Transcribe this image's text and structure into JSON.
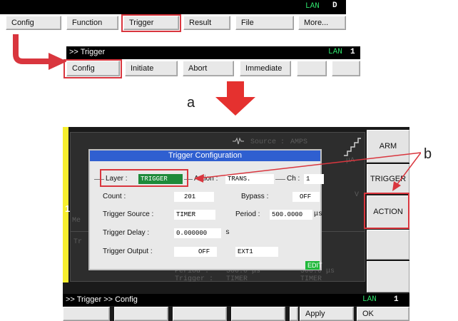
{
  "top_bar": {
    "lan_label": "LAN",
    "lan_value": "D",
    "buttons": [
      "Config",
      "Function",
      "Trigger",
      "Result",
      "File",
      "More..."
    ]
  },
  "second_bar": {
    "title": ">> Trigger",
    "lan_label": "LAN",
    "lan_value": "1",
    "buttons": [
      "Config",
      "Initiate",
      "Abort",
      "Immediate",
      "",
      ""
    ]
  },
  "annotations": {
    "a": "a",
    "b": "b"
  },
  "screen": {
    "channel": "1",
    "background_text": {
      "source": "Source :",
      "source_val": "AMPS",
      "unit": "μA",
      "v": "V",
      "me": "Me",
      "tr": "Tr",
      "period": "Period :",
      "period_val1": "500.0 μs",
      "period_val2": "500.0 μs",
      "trigger": "Trigger :",
      "trigger_val1": "TIMER",
      "trigger_val2": "TIMER"
    },
    "side_buttons": [
      "ARM",
      "TRIGGER",
      "ACTION",
      "",
      ""
    ],
    "bottom_status": {
      "title": ">> Trigger >> Config",
      "lan_label": "LAN",
      "lan_value": "1"
    },
    "bottom_buttons": [
      "",
      "",
      "",
      "",
      "",
      "Apply",
      "OK"
    ]
  },
  "dialog": {
    "title": "Trigger Configuration",
    "layer_label": "Layer :",
    "layer_value": "TRIGGER",
    "action_label": "Action :",
    "action_value": "TRANS.",
    "ch_label": "Ch :",
    "ch_value": "1",
    "count_label": "Count :",
    "count_value": "201",
    "bypass_label": "Bypass :",
    "bypass_value": "OFF",
    "trigger_source_label": "Trigger Source :",
    "trigger_source_value": "TIMER",
    "period_label": "Period :",
    "period_value": "500.0000",
    "period_unit": "μs",
    "trigger_delay_label": "Trigger Delay :",
    "trigger_delay_value": "0.000000",
    "trigger_delay_unit": "s",
    "trigger_output_label": "Trigger Output :",
    "trigger_output_value": "OFF",
    "trigger_output_line": "EXT1",
    "edit_badge": "EDIT"
  },
  "colors": {
    "highlight_red": "#d9363e",
    "lan_green": "#2ee06a",
    "dialog_title_blue": "#2f5fd0",
    "selected_field_green": "#1e8a3a",
    "channel_yellow": "#f6ee2e"
  }
}
